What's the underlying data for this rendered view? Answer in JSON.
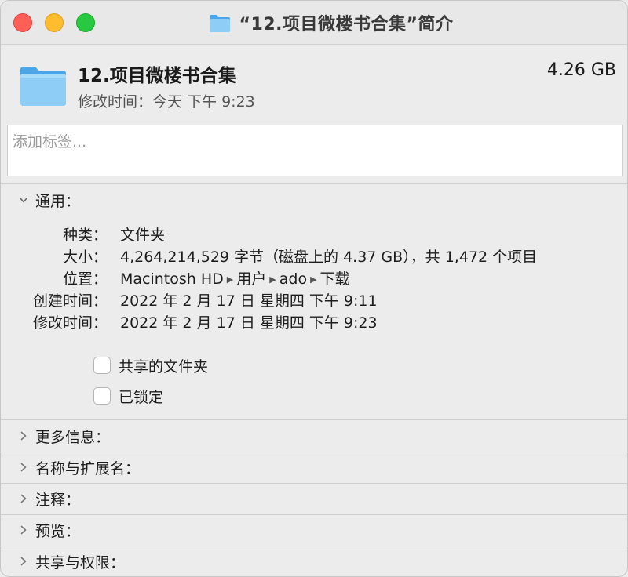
{
  "window": {
    "title": "“12.项目微楼书合集”简介"
  },
  "header": {
    "name": "12.项目微楼书合集",
    "size": "4.26 GB",
    "modified": "修改时间：今天 下午 9:23"
  },
  "tags": {
    "placeholder": "添加标签..."
  },
  "general": {
    "label": "通用：",
    "kind_key": "种类：",
    "kind_value": "文件夹",
    "size_key": "大小：",
    "size_value": "4,264,214,529 字节（磁盘上的 4.37 GB），共 1,472 个项目",
    "where_key": "位置：",
    "where_path": [
      "Macintosh HD",
      "用户",
      "ado",
      "下载"
    ],
    "created_key": "创建时间：",
    "created_value": "2022 年 2 月 17 日 星期四 下午 9:11",
    "modified_key": "修改时间：",
    "modified_value": "2022 年 2 月 17 日 星期四 下午 9:23",
    "shared_folder_label": "共享的文件夹",
    "locked_label": "已锁定"
  },
  "sections": {
    "more_info": "更多信息：",
    "name_extension": "名称与扩展名：",
    "comments": "注释：",
    "preview": "预览：",
    "sharing_permissions": "共享与权限："
  },
  "colors": {
    "folder_light": "#8ecdf5",
    "folder_dark": "#4aa6e8",
    "close": "#fe5f57",
    "minimize": "#febc2e",
    "zoom": "#28c840"
  }
}
